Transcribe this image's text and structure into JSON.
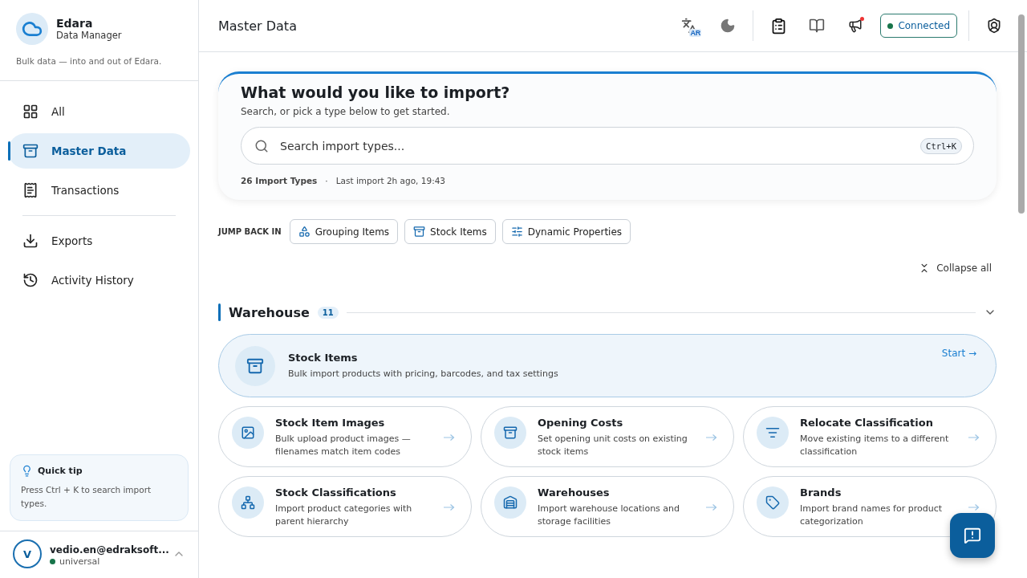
{
  "brand": {
    "name": "Edara",
    "subtitle": "Data Manager",
    "tagline": "Bulk data — into and out of Edara."
  },
  "nav": [
    {
      "label": "All",
      "selected": false
    },
    {
      "label": "Master Data",
      "selected": true
    },
    {
      "label": "Transactions",
      "selected": false
    }
  ],
  "nav_secondary": [
    {
      "label": "Exports",
      "selected": false
    },
    {
      "label": "Activity History",
      "selected": false
    }
  ],
  "tip": {
    "title": "Quick tip",
    "text": "Press Ctrl + K to search import types."
  },
  "user": {
    "initial": "V",
    "email": "vedio.en@edraksoft...",
    "tenant": "universal",
    "online": true
  },
  "header": {
    "title": "Master Data",
    "language_badge": "AR",
    "notification": true,
    "status": "Connected",
    "connected": true
  },
  "hero": {
    "title": "What would you like to import?",
    "subtitle": "Search, or pick a type below to get started.",
    "search_placeholder": "Search import types...",
    "shortcut": "Ctrl+K",
    "count": "26 Import Types",
    "separator": "·",
    "last_import": "Last import 2h ago, 19:43"
  },
  "jump_back": {
    "label": "JUMP BACK IN",
    "items": [
      "Grouping Items",
      "Stock Items",
      "Dynamic Properties"
    ]
  },
  "collapse_label": "Collapse all",
  "section": {
    "title": "Warehouse",
    "count": "11",
    "expanded": true
  },
  "featured": {
    "title": "Stock Items",
    "description": "Bulk import products with pricing, barcodes, and tax settings",
    "action": "Start →"
  },
  "cards": [
    {
      "title": "Stock Item Images",
      "description": "Bulk upload product images — filenames match item codes"
    },
    {
      "title": "Opening Costs",
      "description": "Set opening unit costs on existing stock items"
    },
    {
      "title": "Relocate Classification",
      "description": "Move existing items to a different classification"
    },
    {
      "title": "Stock Classifications",
      "description": "Import product categories with parent hierarchy"
    },
    {
      "title": "Warehouses",
      "description": "Import warehouse locations and storage facilities"
    },
    {
      "title": "Brands",
      "description": "Import brand names for product categorization"
    }
  ]
}
